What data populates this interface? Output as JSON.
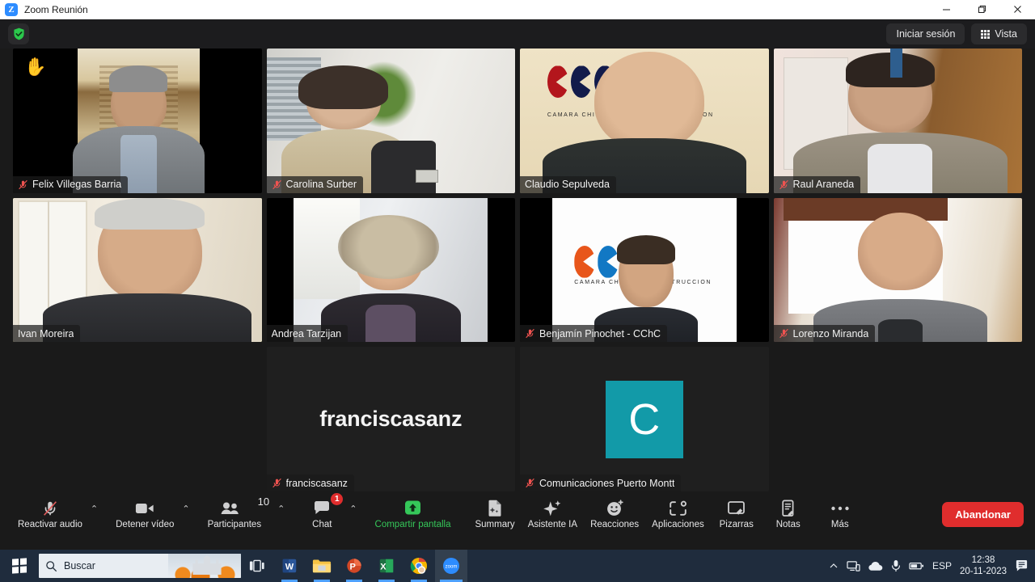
{
  "window": {
    "title": "Zoom Reunión",
    "logo_letter": "Z",
    "controls": {
      "minimize": "minimize-icon",
      "maximize": "restore-icon",
      "close": "close-icon"
    }
  },
  "meeting_header": {
    "encryption_icon": "green-shield-check-icon",
    "sign_in_label": "Iniciar sesión",
    "view_label": "Vista",
    "view_icon": "grid-icon"
  },
  "participants": [
    {
      "name": "Felix Villegas Barria",
      "muted": true,
      "speaking": false,
      "hand_raised": true,
      "video": true,
      "scene": "felix"
    },
    {
      "name": "Carolina Surber",
      "muted": true,
      "speaking": false,
      "hand_raised": false,
      "video": true,
      "scene": "carolina"
    },
    {
      "name": "Claudio Sepulveda",
      "muted": false,
      "speaking": false,
      "hand_raised": false,
      "video": true,
      "scene": "claudio"
    },
    {
      "name": "Raul Araneda",
      "muted": true,
      "speaking": false,
      "hand_raised": false,
      "video": true,
      "scene": "raul"
    },
    {
      "name": "Ivan Moreira",
      "muted": false,
      "speaking": true,
      "hand_raised": false,
      "video": true,
      "scene": "ivan"
    },
    {
      "name": "Andrea Tarzijan",
      "muted": false,
      "speaking": false,
      "hand_raised": false,
      "video": true,
      "scene": "andrea"
    },
    {
      "name": "Benjamín Pinochet - CChC",
      "muted": true,
      "speaking": false,
      "hand_raised": false,
      "video": true,
      "scene": "benjamin"
    },
    {
      "name": "Lorenzo Miranda",
      "muted": true,
      "speaking": false,
      "hand_raised": false,
      "video": true,
      "scene": "lorenzo"
    },
    {
      "name": "franciscasanz",
      "muted": true,
      "speaking": false,
      "hand_raised": false,
      "video": false,
      "display_text": "franciscasanz"
    },
    {
      "name": "Comunicaciones Puerto Montt",
      "muted": true,
      "speaking": false,
      "hand_raised": false,
      "video": false,
      "avatar_letter": "C",
      "avatar_color": "#129AA8"
    }
  ],
  "backdrop_logo": {
    "org_text_left": "CAMARA CHILENA",
    "org_text_right": "CCION",
    "org_text_right_b": "STRUCCION"
  },
  "toolbar": {
    "audio": {
      "label": "Reactivar audio",
      "icon": "microphone-muted-icon",
      "has_menu": true
    },
    "video": {
      "label": "Detener vídeo",
      "icon": "camera-icon",
      "has_menu": true
    },
    "participants": {
      "label": "Participantes",
      "icon": "participants-icon",
      "count": "10",
      "has_menu": true
    },
    "chat": {
      "label": "Chat",
      "icon": "chat-bubble-icon",
      "badge": "1",
      "has_menu": true
    },
    "share": {
      "label": "Compartir pantalla",
      "icon": "share-screen-icon",
      "accent": "#35C759"
    },
    "summary": {
      "label": "Summary",
      "icon": "summary-doc-icon"
    },
    "ai": {
      "label": "Asistente IA",
      "icon": "sparkle-icon"
    },
    "reactions": {
      "label": "Reacciones",
      "icon": "smiley-plus-icon"
    },
    "apps": {
      "label": "Aplicaciones",
      "icon": "apps-icon"
    },
    "whiteboards": {
      "label": "Pizarras",
      "icon": "whiteboard-icon"
    },
    "notes": {
      "label": "Notas",
      "icon": "notes-icon"
    },
    "more": {
      "label": "Más",
      "icon": "ellipsis-icon"
    },
    "leave": {
      "label": "Abandonar",
      "color": "#E02D2D"
    }
  },
  "taskbar": {
    "start_icon": "windows-start-icon",
    "search_placeholder": "Buscar",
    "search_icon": "magnifier-icon",
    "taskview_icon": "task-view-icon",
    "apps": [
      {
        "name": "word-icon",
        "letter": "W"
      },
      {
        "name": "file-explorer-icon",
        "letter": ""
      },
      {
        "name": "powerpoint-icon",
        "letter": "P"
      },
      {
        "name": "excel-icon",
        "letter": "X"
      },
      {
        "name": "chrome-icon",
        "letter": ""
      },
      {
        "name": "zoom-icon",
        "letter": "zoom"
      }
    ],
    "tray": {
      "overflow_icon": "chevron-up-icon",
      "network_icon": "network-icon",
      "onedrive_icon": "cloud-icon",
      "mic_icon": "microphone-icon",
      "power_icon": "battery-icon",
      "language": "ESP",
      "time": "12:38",
      "date": "20-11-2023",
      "notifications_icon": "notifications-icon"
    }
  }
}
